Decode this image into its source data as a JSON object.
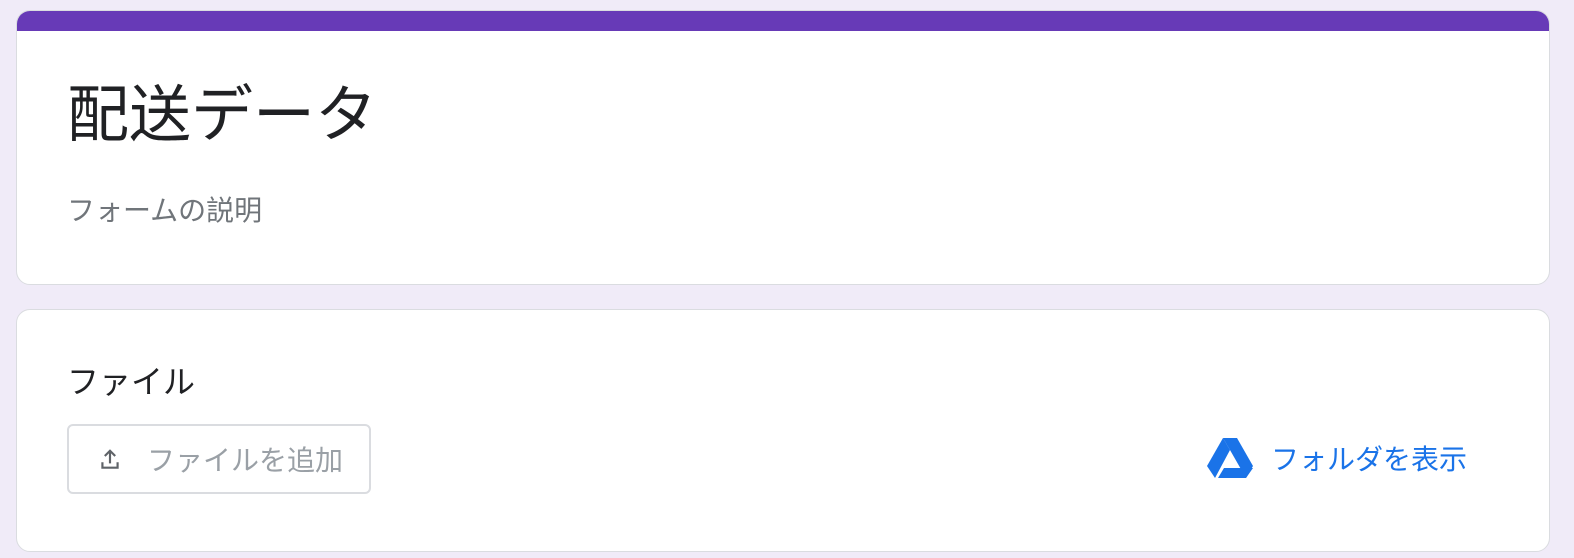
{
  "form": {
    "title": "配送データ",
    "description": "フォームの説明",
    "accent_color": "#673ab7",
    "background_color": "#f0ebf8"
  },
  "question": {
    "title": "ファイル",
    "upload_button": {
      "label": "ファイルを追加",
      "icon": "upload-icon"
    },
    "folder_link": {
      "label": "フォルダを表示",
      "icon": "google-drive-icon",
      "color": "#1a73e8"
    }
  }
}
